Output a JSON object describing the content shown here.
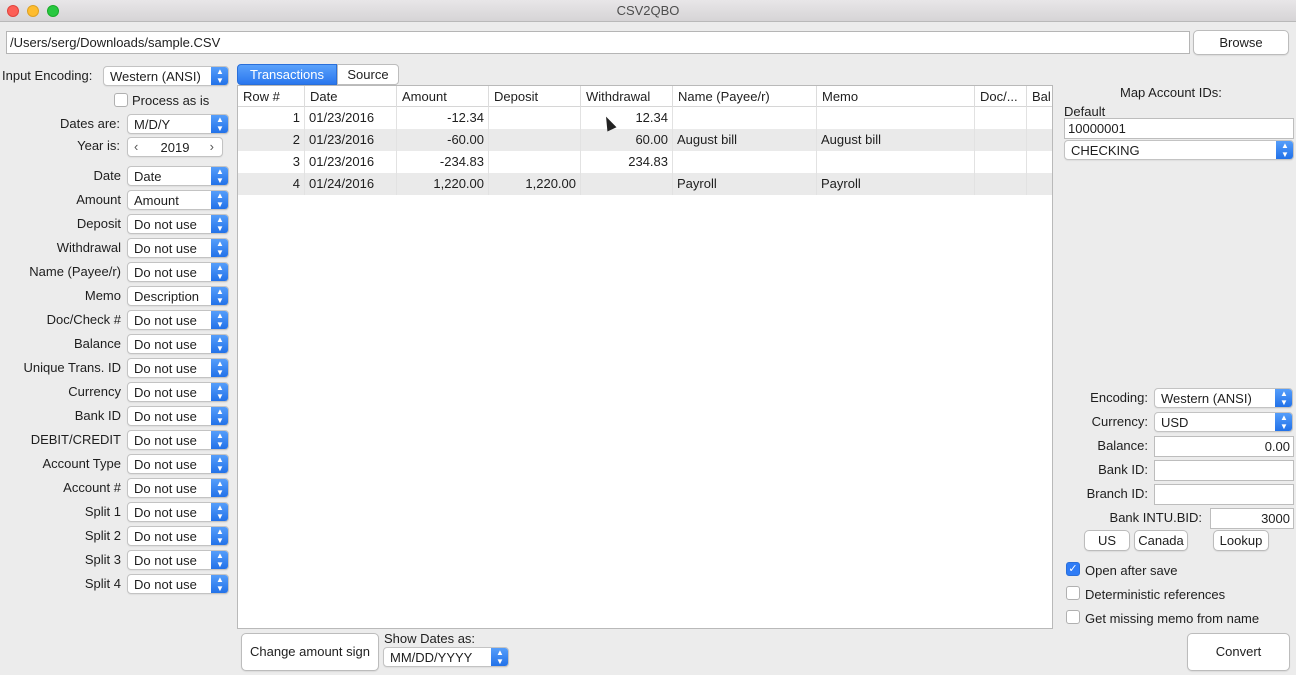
{
  "window": {
    "title": "CSV2QBO"
  },
  "file": {
    "path": "/Users/serg/Downloads/sample.CSV",
    "browse_label": "Browse"
  },
  "left": {
    "input_encoding_label": "Input Encoding:",
    "input_encoding_value": "Western (ANSI)",
    "process_as_is_label": "Process as is",
    "dates_are_label": "Dates are:",
    "dates_are_value": "M/D/Y",
    "year_is_label": "Year is:",
    "year_value": "2019",
    "year_prev": "‹",
    "year_next": "›",
    "mappings": [
      {
        "label": "Date",
        "value": "Date"
      },
      {
        "label": "Amount",
        "value": "Amount"
      },
      {
        "label": "Deposit",
        "value": "Do not use"
      },
      {
        "label": "Withdrawal",
        "value": "Do not use"
      },
      {
        "label": "Name (Payee/r)",
        "value": "Do not use"
      },
      {
        "label": "Memo",
        "value": "Description"
      },
      {
        "label": "Doc/Check #",
        "value": "Do not use"
      },
      {
        "label": "Balance",
        "value": "Do not use"
      },
      {
        "label": "Unique Trans. ID",
        "value": "Do not use"
      },
      {
        "label": "Currency",
        "value": "Do not use"
      },
      {
        "label": "Bank ID",
        "value": "Do not use"
      },
      {
        "label": "DEBIT/CREDIT",
        "value": "Do not use"
      },
      {
        "label": "Account Type",
        "value": "Do not use"
      },
      {
        "label": "Account #",
        "value": "Do not use"
      },
      {
        "label": "Split 1",
        "value": "Do not use"
      },
      {
        "label": "Split 2",
        "value": "Do not use"
      },
      {
        "label": "Split 3",
        "value": "Do not use"
      },
      {
        "label": "Split 4",
        "value": "Do not use"
      }
    ]
  },
  "tabs": [
    {
      "label": "Transactions",
      "active": true
    },
    {
      "label": "Source",
      "active": false
    }
  ],
  "table": {
    "columns": [
      "Row #",
      "Date",
      "Amount",
      "Deposit",
      "Withdrawal",
      "Name (Payee/r)",
      "Memo",
      "Doc/...",
      "Bal"
    ],
    "rows": [
      [
        "1",
        "01/23/2016",
        "-12.34",
        "",
        "12.34",
        "",
        "",
        "",
        ""
      ],
      [
        "2",
        "01/23/2016",
        "-60.00",
        "",
        "60.00",
        "August bill",
        "August bill",
        "",
        ""
      ],
      [
        "3",
        "01/23/2016",
        "-234.83",
        "",
        "234.83",
        "",
        "",
        "",
        ""
      ],
      [
        "4",
        "01/24/2016",
        "1,220.00",
        "1,220.00",
        "",
        "Payroll",
        "Payroll",
        "",
        ""
      ]
    ]
  },
  "bottom": {
    "change_sign_label": "Change amount sign",
    "show_dates_label": "Show Dates as:",
    "show_dates_value": "MM/DD/YYYY",
    "convert_label": "Convert"
  },
  "right": {
    "map_title": "Map Account IDs:",
    "default_label": "Default",
    "default_account": "10000001",
    "account_type": "CHECKING",
    "encoding_label": "Encoding:",
    "encoding_value": "Western (ANSI)",
    "currency_label": "Currency:",
    "currency_value": "USD",
    "balance_label": "Balance:",
    "balance_value": "0.00",
    "bank_id_label": "Bank ID:",
    "bank_id_value": "",
    "branch_id_label": "Branch ID:",
    "branch_id_value": "",
    "intu_bid_label": "Bank INTU.BID:",
    "intu_bid_value": "3000",
    "us_label": "US",
    "canada_label": "Canada",
    "lookup_label": "Lookup",
    "open_after_save_label": "Open after save",
    "deterministic_label": "Deterministic references",
    "missing_memo_label": "Get missing memo from name"
  },
  "colors": {
    "accent": "#2f7cf6",
    "alt_row": "#eaeaea"
  }
}
